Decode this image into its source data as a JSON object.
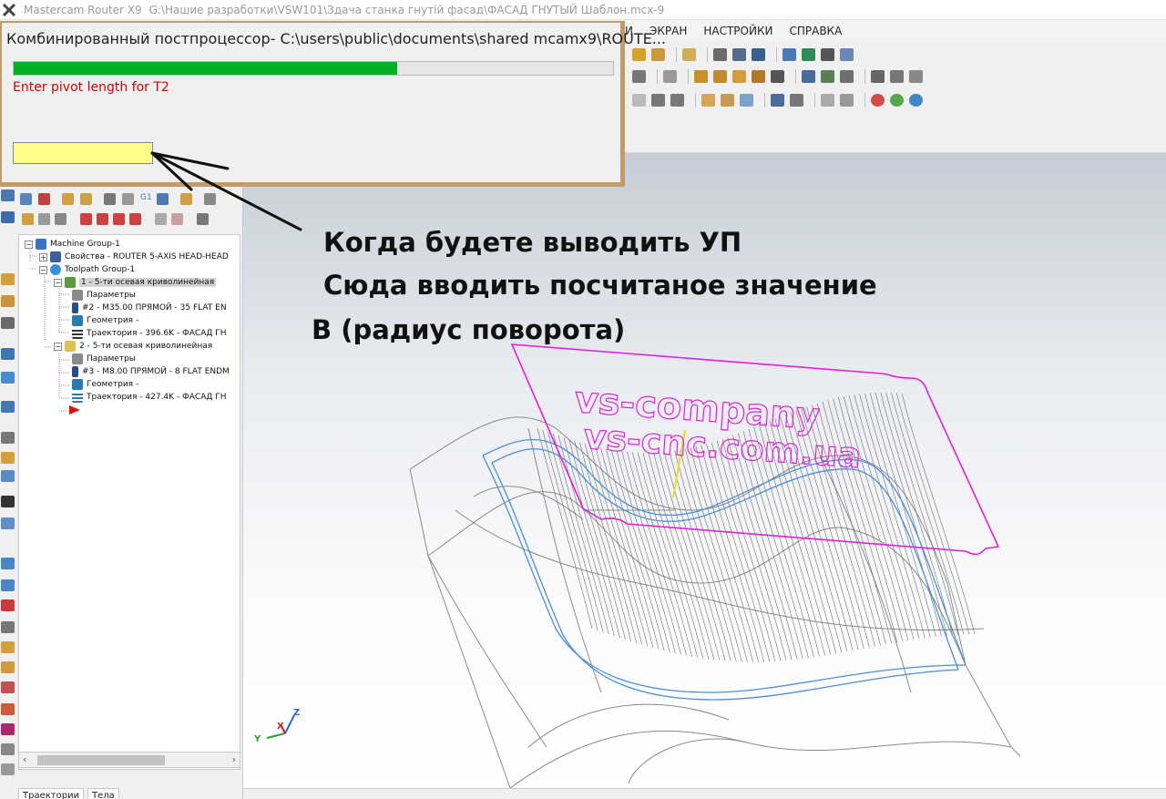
{
  "window": {
    "app_title": "Mastercam Router X9",
    "file_path": "G:\\Нашие разработки\\VSW101\\Здача станка гнутій фасад\\ФАСАД ГНУТЫЙ Шаблон.mcx-9"
  },
  "menu": [
    "И",
    "ЭКРАН",
    "НАСТРОЙКИ",
    "СПРАВКА"
  ],
  "dialog": {
    "title": "Комбинированный постпроцессор- C:\\users\\public\\documents\\shared mcamx9\\ROUTE...",
    "progress": 0.64,
    "prompt": "Enter pivot length for T2",
    "input_value": ""
  },
  "annotation": {
    "line1": "Когда будете выводить УП",
    "line2": "Сюда вводить посчитаное значение",
    "line3": "В (радиус поворота)"
  },
  "tree": {
    "machine_group": "Machine Group-1",
    "properties": "Свойства - ROUTER 5-AXIS HEAD-HEAD",
    "toolpath_group": "Toolpath Group-1",
    "op1": {
      "label": "1 - 5-ти осевая криволинейная",
      "params": "Параметры",
      "tool": "#2 - M35.00 ПРЯМОЙ - 35 FLAT EN",
      "geometry": "Геометрия -",
      "trajectory": "Траектория - 396.6K - ФАСАД ГН"
    },
    "op2": {
      "label": "2 - 5-ти осевая криволинейная",
      "params": "Параметры",
      "tool": "#3 - M8.00 ПРЯМОЙ - 8 FLAT ENDM",
      "geometry": "Геометрия -",
      "trajectory": "Траектория - 427.4K - ФАСАД ГН"
    },
    "ops_toolbar_label": "G1"
  },
  "tabs": [
    "Траектории",
    "Тела"
  ],
  "watermark": {
    "line1": "vs-company",
    "line2": "vs-cnc.com.ua"
  },
  "axes": {
    "x": "X",
    "y": "Y",
    "z": "Z"
  },
  "colors": {
    "dialog_frame": "#c19b68",
    "progress": "#06b025",
    "prompt": "#d00000",
    "input_bg": "#ffff88",
    "magenta": "#e020e0",
    "toolpath_blue": "#4a8ede"
  }
}
